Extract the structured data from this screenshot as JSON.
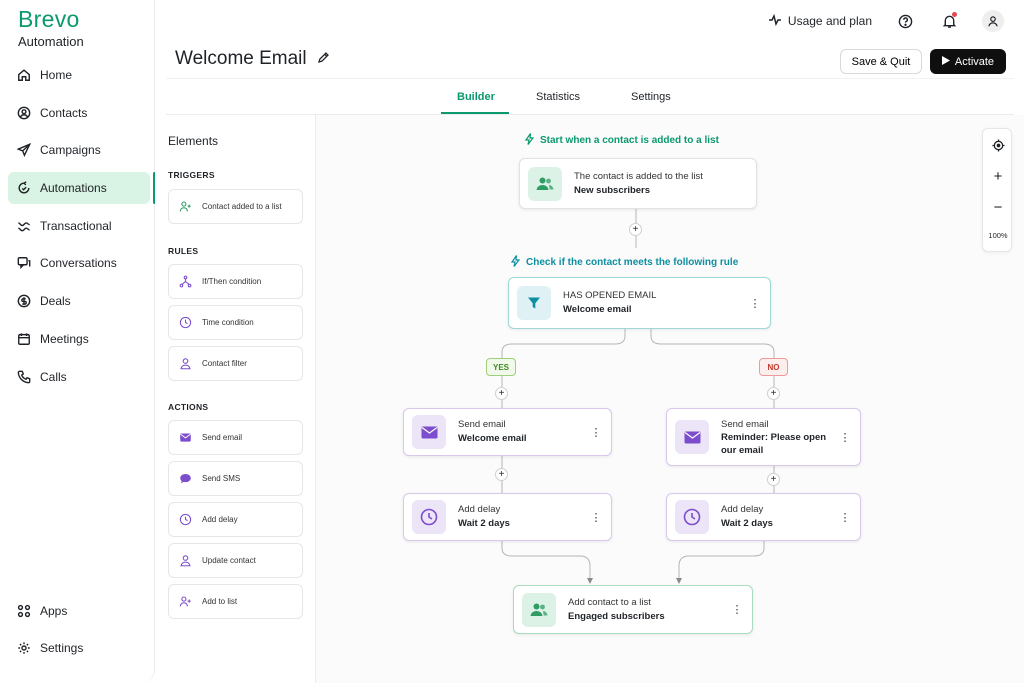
{
  "brand": {
    "name": "Brevo",
    "product": "Automation"
  },
  "sidebar": {
    "items": [
      {
        "label": "Home",
        "icon": "home-icon"
      },
      {
        "label": "Contacts",
        "icon": "contacts-icon"
      },
      {
        "label": "Campaigns",
        "icon": "send-icon"
      },
      {
        "label": "Automations",
        "icon": "automation-icon",
        "active": true
      },
      {
        "label": "Transactional",
        "icon": "transactional-icon"
      },
      {
        "label": "Conversations",
        "icon": "chat-icon"
      },
      {
        "label": "Deals",
        "icon": "deals-icon"
      },
      {
        "label": "Meetings",
        "icon": "calendar-icon"
      },
      {
        "label": "Calls",
        "icon": "phone-icon"
      }
    ],
    "bottom": [
      {
        "label": "Apps",
        "icon": "apps-icon"
      },
      {
        "label": "Settings",
        "icon": "gear-icon"
      }
    ]
  },
  "topbar": {
    "usage_label": "Usage and plan"
  },
  "header": {
    "title": "Welcome Email",
    "save_label": "Save & Quit",
    "activate_label": "Activate"
  },
  "tabs": [
    {
      "label": "Builder",
      "active": true
    },
    {
      "label": "Statistics"
    },
    {
      "label": "Settings"
    }
  ],
  "elements": {
    "title": "Elements",
    "triggers_heading": "TRIGGERS",
    "triggers": [
      "Contact added to a list"
    ],
    "rules_heading": "RULES",
    "rules": [
      "If/Then condition",
      "Time condition",
      "Contact filter"
    ],
    "actions_heading": "ACTIONS",
    "actions": [
      "Send email",
      "Send SMS",
      "Add delay",
      "Update contact",
      "Add to list"
    ]
  },
  "workflow": {
    "start_label": "Start when a contact is added to a list",
    "trigger": {
      "line1": "The contact is added to the list",
      "line2": "New subscribers"
    },
    "rule_label": "Check if the contact meets the following rule",
    "condition": {
      "line1": "HAS OPENED EMAIL",
      "line2": "Welcome email"
    },
    "yes_label": "YES",
    "no_label": "NO",
    "yes_email": {
      "line1": "Send email",
      "line2": "Welcome email"
    },
    "no_email": {
      "line1": "Send email",
      "line2": "Reminder: Please open",
      "line3": "our email"
    },
    "yes_delay": {
      "line1": "Add delay",
      "line2": "Wait 2 days"
    },
    "no_delay": {
      "line1": "Add delay",
      "line2": "Wait 2 days"
    },
    "final": {
      "line1": "Add contact to a list",
      "line2": "Engaged subscribers"
    }
  },
  "zoom": {
    "level": "100%"
  },
  "colors": {
    "brand": "#0b996e",
    "active_bg": "#d9f3e4",
    "teal": "#0e8fa0",
    "purple": "#7c4dcc"
  }
}
